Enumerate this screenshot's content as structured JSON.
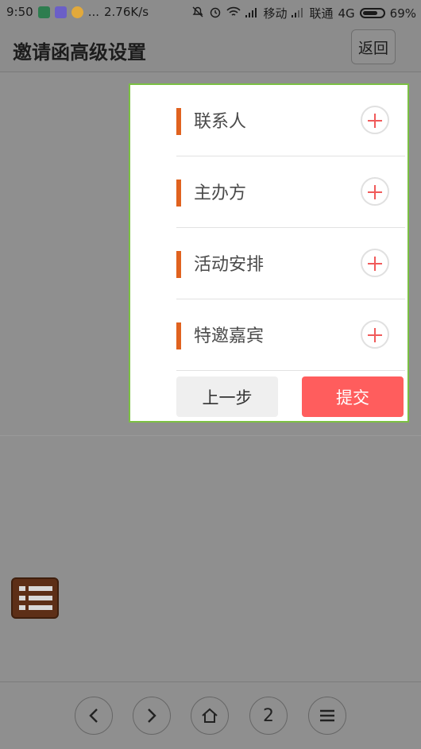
{
  "status_bar": {
    "time": "9:50",
    "more": "...",
    "speed": "2.76K/s",
    "carrier1": "移动",
    "carrier2": "联通",
    "network": "4G",
    "battery": "69%"
  },
  "header": {
    "title": "邀请函高级设置",
    "back_label": "返回"
  },
  "popup": {
    "items": [
      {
        "label": "联系人"
      },
      {
        "label": "主办方"
      },
      {
        "label": "活动安排"
      },
      {
        "label": "特邀嘉宾"
      }
    ],
    "prev_label": "上一步",
    "submit_label": "提交"
  },
  "bottom_nav": {
    "page_number": "2"
  },
  "colors": {
    "accent_orange": "#e0621f",
    "submit_red": "#ff5d5d",
    "popup_border": "#7bc043"
  }
}
